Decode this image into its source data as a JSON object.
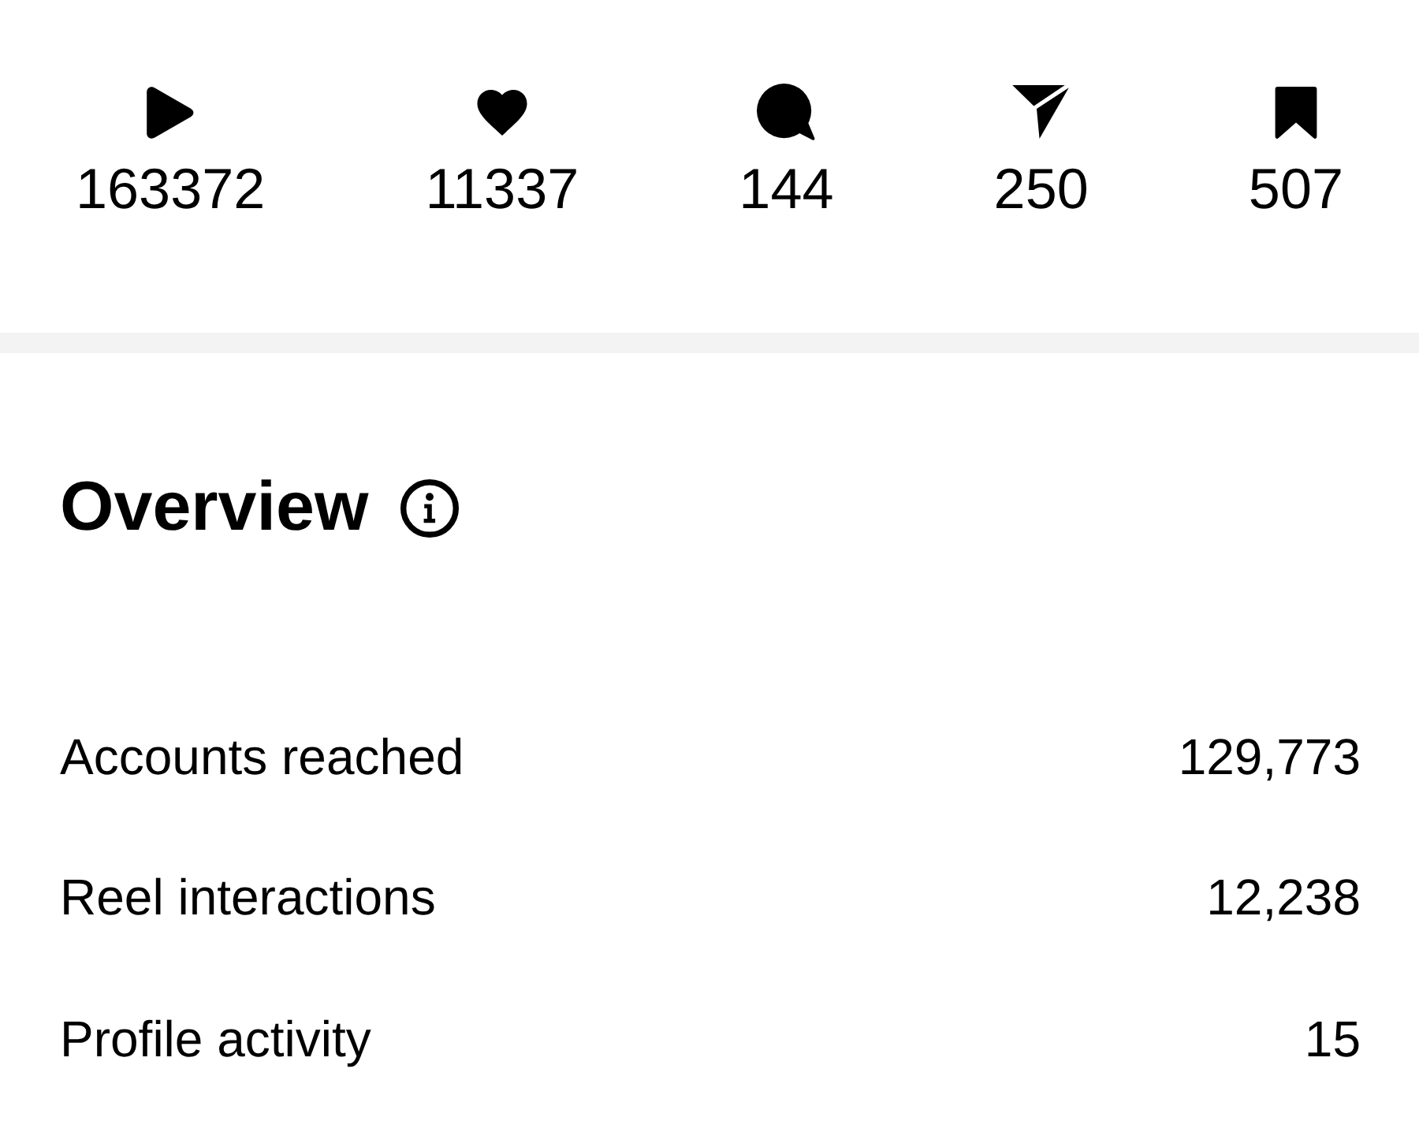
{
  "stats": [
    {
      "kind": "play",
      "count": "163372"
    },
    {
      "kind": "like",
      "count": "11337"
    },
    {
      "kind": "comment",
      "count": "144"
    },
    {
      "kind": "share",
      "count": "250"
    },
    {
      "kind": "save",
      "count": "507"
    }
  ],
  "overview": {
    "title": "Overview",
    "rows": [
      {
        "label": "Accounts reached",
        "value": "129,773"
      },
      {
        "label": "Reel interactions",
        "value": "12,238"
      },
      {
        "label": "Profile activity",
        "value": "15"
      }
    ]
  }
}
